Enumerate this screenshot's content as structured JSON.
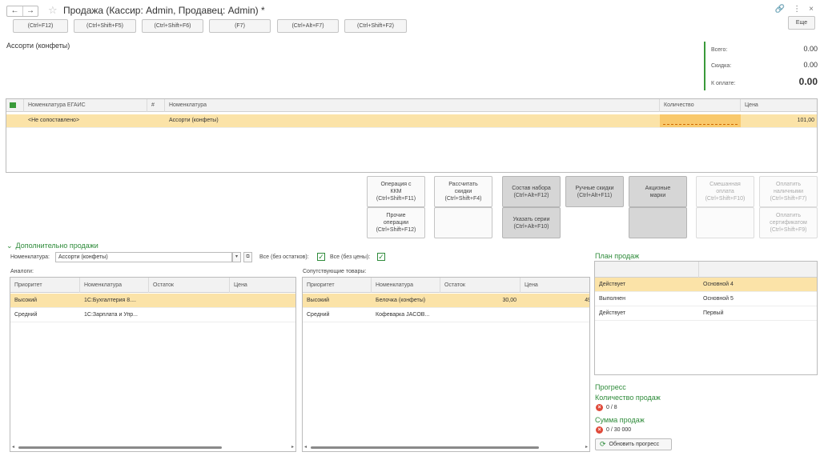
{
  "window": {
    "title": "Продажа (Кассир: Admin, Продавец: Admin) *",
    "nav_back": "←",
    "nav_forward": "→",
    "star_glyph": "☆",
    "link_glyph": "🔗",
    "more_glyph": "⋮",
    "close_glyph": "×"
  },
  "top_buttons": [
    {
      "label": "(Ctrl+F12)"
    },
    {
      "label": "(Ctrl+Shift+F5)"
    },
    {
      "label": "(Ctrl+Shift+F6)"
    },
    {
      "label": "(F7)"
    },
    {
      "label": "(Ctrl+Alt+F7)"
    },
    {
      "label": "(Ctrl+Shift+F2)"
    },
    {
      "label": "Еще"
    }
  ],
  "item_name": "Ассорти (конфеты)",
  "totals": {
    "total_label": "Всего:",
    "total_value": "0.00",
    "discount_label": "Скидка:",
    "discount_value": "0.00",
    "pay_label": "К оплате:",
    "pay_value": "0.00"
  },
  "main_table": {
    "columns": {
      "egais": "Номенклатура ЕГАИС",
      "nomen": "Номенклатура",
      "qty": "Количество",
      "price": "Цена"
    },
    "rows": [
      {
        "egais": "<Не сопоставлено>",
        "nomen": "Ассорти (конфеты)",
        "qty": "",
        "price": "101,00"
      }
    ]
  },
  "action_buttons": {
    "kkm": "Операция с\nККМ\n(Ctrl+Shift+F11)",
    "discounts": "Рассчитать\nскидки\n(Ctrl+Shift+F4)",
    "set": "Состав набора\n(Ctrl+Alt+F12)",
    "manual": "Ручные скидки\n(Ctrl+Alt+F11)",
    "excise": "Акцизные\nмарки",
    "mixed": "Смешанная\nоплата\n(Ctrl+Shift+F10)",
    "cash": "Оплатить\nналичными\n(Ctrl+Shift+F7)",
    "other": "Прочие\nоперации\n(Ctrl+Shift+F12)",
    "series": "Указать серии\n(Ctrl+Alt+F10)",
    "cert": "Оплатить\nсертификатом\n(Ctrl+Shift+F9)"
  },
  "extra": {
    "section_title": "Дополнительно продажи",
    "chevron": "⌄",
    "nomen_label": "Номенклатура:",
    "nomen_value": "Ассорти (конфеты)",
    "all_no_stock_label": "Все (без остатков):",
    "all_no_price_label": "Все (без цены):",
    "check_glyph": "✓",
    "dropdown_glyph": "▾",
    "open_glyph": "⧉",
    "analogs_label": "Аналоги:",
    "related_label": "Сопутствующие товары:",
    "analogs": {
      "columns": {
        "priority": "Приоритет",
        "nomen": "Номенклатура",
        "stock": "Остаток",
        "price": "Цена"
      },
      "rows": [
        {
          "priority": "Высокий",
          "nomen": "1С:Бухгалтерия 8....",
          "stock": "",
          "price": ""
        },
        {
          "priority": "Средний",
          "nomen": "1С:Зарплата и Упр...",
          "stock": "",
          "price": ""
        }
      ]
    },
    "related": {
      "columns": {
        "priority": "Приоритет",
        "nomen": "Номенклатура",
        "stock": "Остаток",
        "price": "Цена"
      },
      "rows": [
        {
          "priority": "Высокий",
          "nomen": "Белочка (конфеты)",
          "stock": "30,00",
          "price": "49"
        },
        {
          "priority": "Средний",
          "nomen": "Кофеварка JACOB...",
          "stock": "",
          "price": ""
        }
      ]
    }
  },
  "sales_plan": {
    "title": "План продаж",
    "rows": [
      {
        "status": "Действует",
        "name": "Основной 4"
      },
      {
        "status": "Выполнен",
        "name": "Основной 5"
      },
      {
        "status": "Действует",
        "name": "Первый"
      }
    ],
    "progress_title": "Прогресс",
    "count_title": "Количество продаж",
    "count_value": "0 / 8",
    "sum_title": "Сумма продаж",
    "sum_value": "0 / 30 000",
    "refresh_label": "Обновить прогресс",
    "err_glyph": "×",
    "refresh_glyph": "⟳"
  },
  "colors": {
    "accent_green": "#2e8b3a",
    "selection": "#fbe3a8",
    "error": "#e04a3a"
  }
}
